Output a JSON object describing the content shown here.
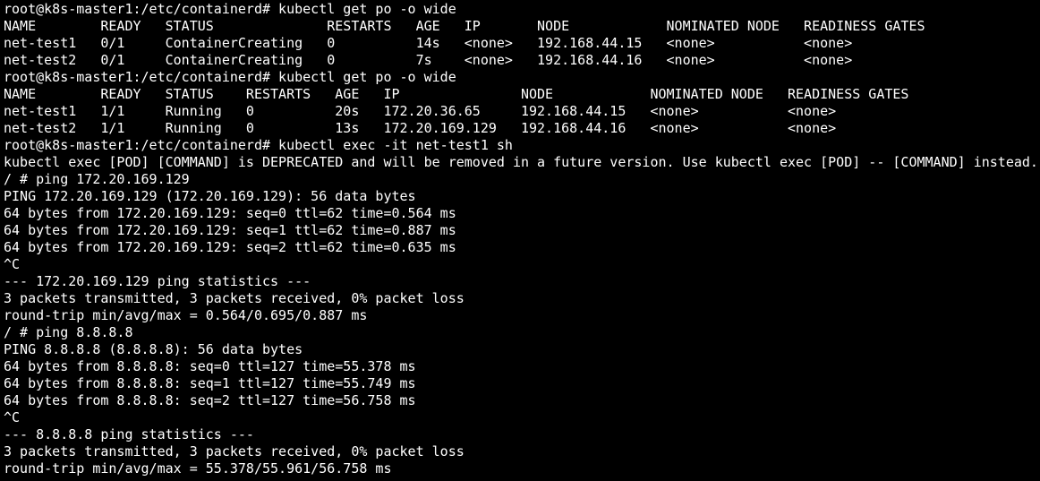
{
  "terminal": {
    "colors": {
      "background": "#000000",
      "foreground": "#ffffff",
      "cursor": "#1ad61a"
    },
    "lines": [
      "root@k8s-master1:/etc/containerd# kubectl get po -o wide",
      "NAME        READY   STATUS              RESTARTS   AGE   IP       NODE            NOMINATED NODE   READINESS GATES",
      "net-test1   0/1     ContainerCreating   0          14s   <none>   192.168.44.15   <none>           <none>",
      "net-test2   0/1     ContainerCreating   0          7s    <none>   192.168.44.16   <none>           <none>",
      "root@k8s-master1:/etc/containerd# kubectl get po -o wide",
      "NAME        READY   STATUS    RESTARTS   AGE   IP               NODE            NOMINATED NODE   READINESS GATES",
      "net-test1   1/1     Running   0          20s   172.20.36.65     192.168.44.15   <none>           <none>",
      "net-test2   1/1     Running   0          13s   172.20.169.129   192.168.44.16   <none>           <none>",
      "root@k8s-master1:/etc/containerd# kubectl exec -it net-test1 sh",
      "kubectl exec [POD] [COMMAND] is DEPRECATED and will be removed in a future version. Use kubectl exec [POD] -- [COMMAND] instead.",
      "/ # ping 172.20.169.129",
      "PING 172.20.169.129 (172.20.169.129): 56 data bytes",
      "64 bytes from 172.20.169.129: seq=0 ttl=62 time=0.564 ms",
      "64 bytes from 172.20.169.129: seq=1 ttl=62 time=0.887 ms",
      "64 bytes from 172.20.169.129: seq=2 ttl=62 time=0.635 ms",
      "^C",
      "--- 172.20.169.129 ping statistics ---",
      "3 packets transmitted, 3 packets received, 0% packet loss",
      "round-trip min/avg/max = 0.564/0.695/0.887 ms",
      "/ # ping 8.8.8.8",
      "PING 8.8.8.8 (8.8.8.8): 56 data bytes",
      "64 bytes from 8.8.8.8: seq=0 ttl=127 time=55.378 ms",
      "64 bytes from 8.8.8.8: seq=1 ttl=127 time=55.749 ms",
      "64 bytes from 8.8.8.8: seq=2 ttl=127 time=56.758 ms",
      "^C",
      "--- 8.8.8.8 ping statistics ---",
      "3 packets transmitted, 3 packets received, 0% packet loss",
      "round-trip min/avg/max = 55.378/55.961/56.758 ms"
    ]
  }
}
